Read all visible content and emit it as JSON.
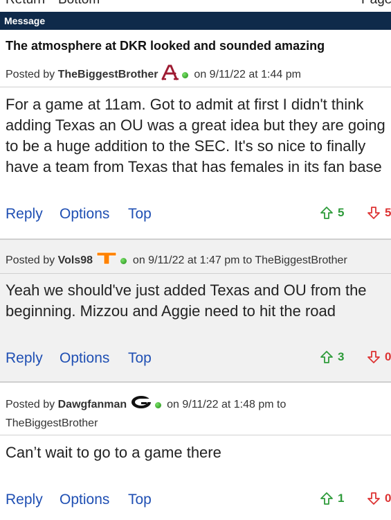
{
  "nav": {
    "return_label": "Return",
    "bottom_label": "Bottom",
    "page_label": "Page"
  },
  "header": {
    "section_label": "Message"
  },
  "thread": {
    "title": "The atmosphere at DKR looked and sounded amazing"
  },
  "labels": {
    "posted_by": "Posted by",
    "on": "on",
    "to": "to"
  },
  "actions": {
    "reply": "Reply",
    "options": "Options",
    "top": "Top"
  },
  "posts": [
    {
      "user": "TheBiggestBrother",
      "team_logo": "alabama-a-logo",
      "date": "9/11/22 at 1:44 pm",
      "to": "",
      "body_lines": [
        "For a game at 11am. Got to admit at first I didn't think",
        "adding Texas an OU was a great idea but they are going",
        "to be a huge addition to the SEC. It's so nice to finally",
        "have a team from Texas that has females in its fan base"
      ],
      "upvotes": "5",
      "downvotes": "5"
    },
    {
      "user": "Vols98",
      "team_logo": "tennessee-t-logo",
      "date": "9/11/22 at 1:47 pm",
      "to": "TheBiggestBrother",
      "body_lines": [
        "Yeah we should've just added Texas and OU from the",
        "beginning. Mizzou and Aggie need to hit the road"
      ],
      "upvotes": "3",
      "downvotes": "0"
    },
    {
      "user": "Dawgfanman",
      "team_logo": "georgia-g-logo",
      "date": "9/11/22 at 1:48 pm",
      "to": "TheBiggestBrother",
      "body_lines": [
        "Can’t wait to go to a game there"
      ],
      "upvotes": "1",
      "downvotes": "0"
    }
  ],
  "colors": {
    "header_bg": "#0f2a4a",
    "link": "#1f4fb3",
    "upvote": "#2e9b3a",
    "downvote": "#dd3333",
    "online": "#2fa31e"
  }
}
